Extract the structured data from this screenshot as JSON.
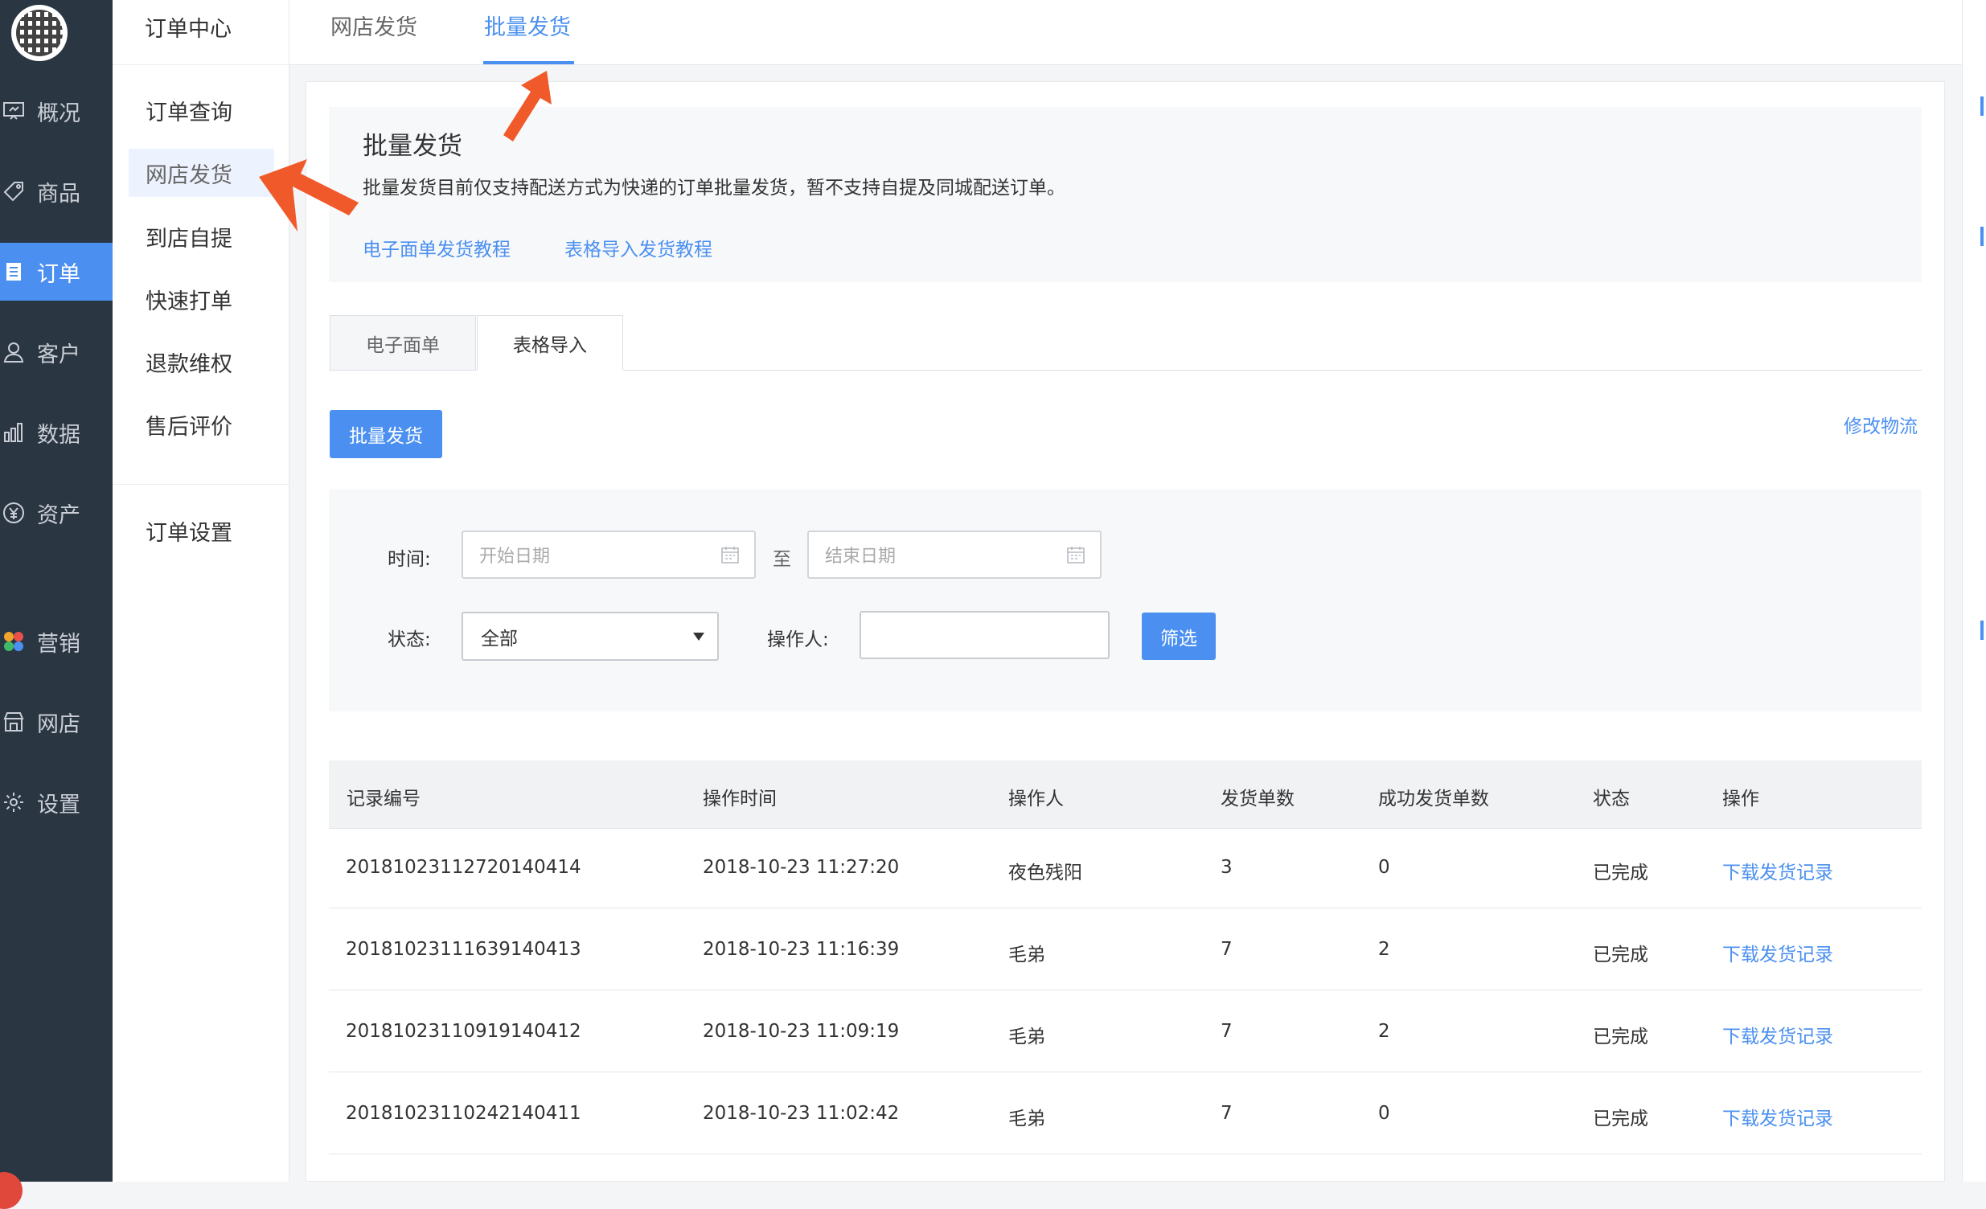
{
  "nav_primary": {
    "items": [
      {
        "label": "概况",
        "icon": "presentation-icon"
      },
      {
        "label": "商品",
        "icon": "tag-icon"
      },
      {
        "label": "订单",
        "icon": "document-icon",
        "active": true
      },
      {
        "label": "客户",
        "icon": "person-icon"
      },
      {
        "label": "数据",
        "icon": "bar-chart-icon"
      },
      {
        "label": "资产",
        "icon": "yen-icon"
      },
      {
        "label": "营销",
        "icon": "colored-dots-icon"
      },
      {
        "label": "网店",
        "icon": "store-icon"
      },
      {
        "label": "设置",
        "icon": "gear-icon"
      }
    ]
  },
  "nav_secondary": {
    "title": "订单中心",
    "items": [
      {
        "label": "订单查询"
      },
      {
        "label": "网店发货",
        "active": true
      },
      {
        "label": "到店自提"
      },
      {
        "label": "快速打单"
      },
      {
        "label": "退款维权"
      },
      {
        "label": "售后评价"
      }
    ],
    "settings": "订单设置"
  },
  "top_tabs": [
    {
      "label": "网店发货"
    },
    {
      "label": "批量发货",
      "active": true
    }
  ],
  "intro": {
    "title": "批量发货",
    "description": "批量发货目前仅支持配送方式为快递的订单批量发货，暂不支持自提及同城配送订单。",
    "links": [
      "电子面单发货教程",
      "表格导入发货教程"
    ]
  },
  "sub_tabs": [
    {
      "label": "电子面单"
    },
    {
      "label": "表格导入",
      "active": true
    }
  ],
  "actions": {
    "batch_ship": "批量发货",
    "modify_logistics": "修改物流"
  },
  "filter": {
    "time_label": "时间:",
    "start_placeholder": "开始日期",
    "to_label": "至",
    "end_placeholder": "结束日期",
    "status_label": "状态:",
    "status_value": "全部",
    "operator_label": "操作人:",
    "operator_value": "",
    "filter_button": "筛选"
  },
  "table": {
    "columns": [
      "记录编号",
      "操作时间",
      "操作人",
      "发货单数",
      "成功发货单数",
      "状态",
      "操作"
    ],
    "rows": [
      {
        "id": "20181023112720140414",
        "time": "2018-10-23 11:27:20",
        "operator": "夜色残阳",
        "count": "3",
        "success": "0",
        "status": "已完成",
        "action": "下载发货记录"
      },
      {
        "id": "20181023111639140413",
        "time": "2018-10-23 11:16:39",
        "operator": "毛弟",
        "count": "7",
        "success": "2",
        "status": "已完成",
        "action": "下载发货记录"
      },
      {
        "id": "20181023110919140412",
        "time": "2018-10-23 11:09:19",
        "operator": "毛弟",
        "count": "7",
        "success": "2",
        "status": "已完成",
        "action": "下载发货记录"
      },
      {
        "id": "20181023110242140411",
        "time": "2018-10-23 11:02:42",
        "operator": "毛弟",
        "count": "7",
        "success": "0",
        "status": "已完成",
        "action": "下载发货记录"
      }
    ]
  },
  "colors": {
    "accent": "#4b90f0",
    "nav_bg": "#2b3643",
    "annotation_arrow": "#f05a2a"
  }
}
